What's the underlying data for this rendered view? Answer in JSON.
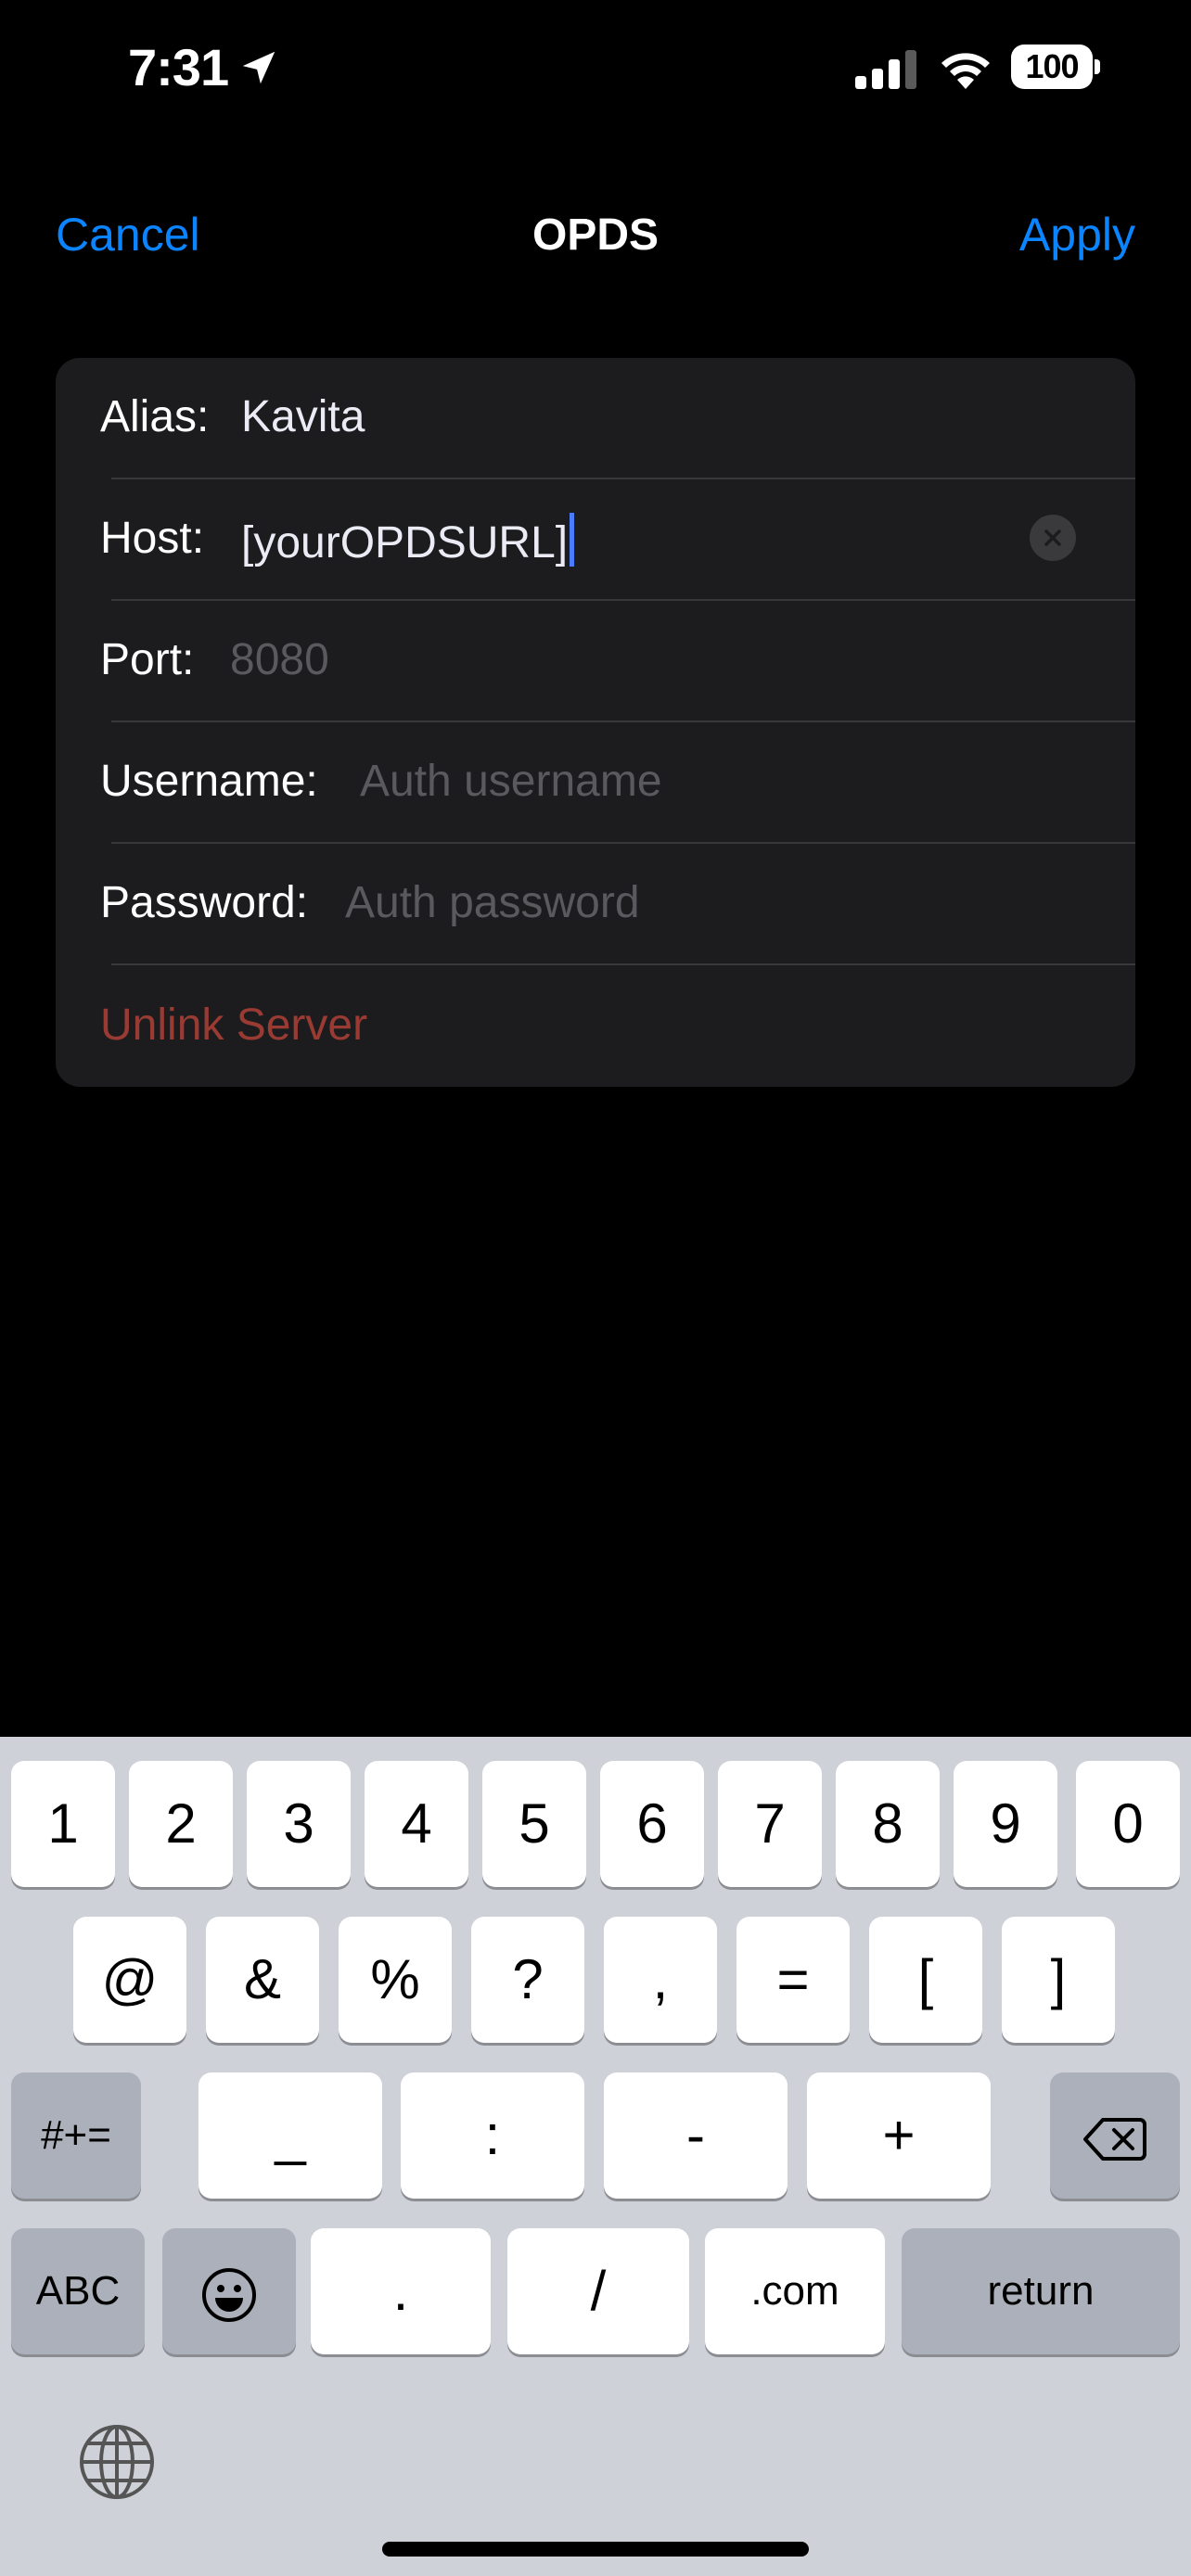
{
  "status_bar": {
    "time": "7:31",
    "battery": "100"
  },
  "nav": {
    "cancel_label": "Cancel",
    "title": "OPDS",
    "apply_label": "Apply"
  },
  "form": {
    "alias": {
      "label": "Alias:",
      "value": "Kavita"
    },
    "host": {
      "label": "Host:",
      "value": "[yourOPDSURL]"
    },
    "port": {
      "label": "Port:",
      "placeholder": "8080"
    },
    "username": {
      "label": "Username:",
      "placeholder": "Auth username"
    },
    "password": {
      "label": "Password:",
      "placeholder": "Auth password"
    },
    "unlink_label": "Unlink Server"
  },
  "keyboard": {
    "row1": [
      "1",
      "2",
      "3",
      "4",
      "5",
      "6",
      "7",
      "8",
      "9",
      "0"
    ],
    "row2": [
      "@",
      "&",
      "%",
      "?",
      ",",
      "=",
      "[",
      "]"
    ],
    "row3": [
      "_",
      ":",
      "-",
      "+"
    ],
    "symbols_toggle": "#+=",
    "abc_label": "ABC",
    "period": ".",
    "slash": "/",
    "dotcom": ".com",
    "return_label": "return"
  },
  "colors": {
    "accent": "#0a84ff",
    "destructive": "#9a3b33",
    "card": "#1c1c1e",
    "keyboard_bg": "#ced1d8"
  }
}
